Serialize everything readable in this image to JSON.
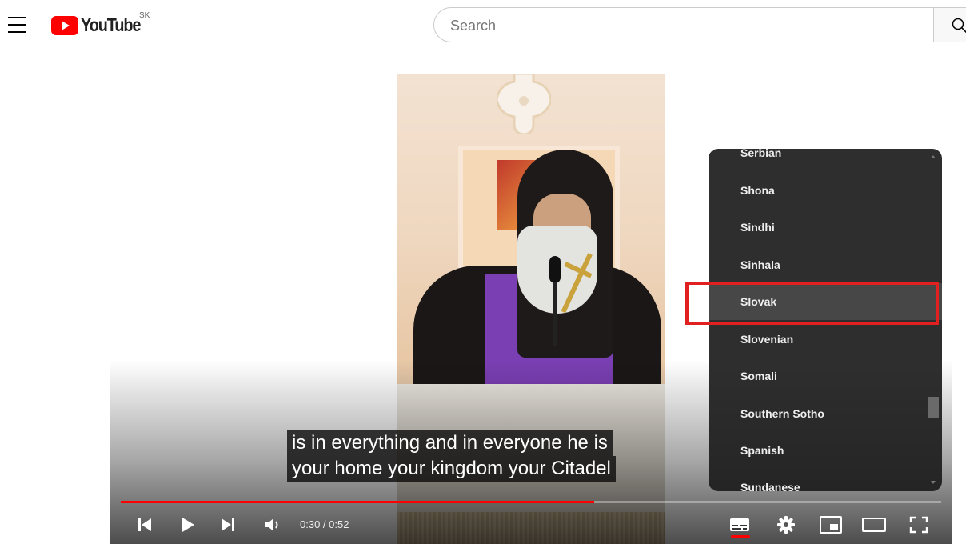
{
  "header": {
    "logo_text": "YouTube",
    "country_code": "SK",
    "search": {
      "placeholder": "Search",
      "value": ""
    }
  },
  "player": {
    "caption_lines": [
      "is in everything and in everyone he is",
      "your home your kingdom your Citadel"
    ],
    "progress": 0.577,
    "time_current": "0:30",
    "time_total": "0:52",
    "time_display": "0:30 / 0:52"
  },
  "language_menu": {
    "items": [
      "Serbian",
      "Shona",
      "Sindhi",
      "Sinhala",
      "Slovak",
      "Slovenian",
      "Somali",
      "Southern Sotho",
      "Spanish",
      "Sundanese"
    ],
    "selected": "Slovak"
  },
  "colors": {
    "brand_red": "#ff0000",
    "highlight_outline": "#e0211f",
    "menu_background": "#1c1c1c"
  },
  "icons": {
    "menu": "hamburger-menu-icon",
    "search": "search-icon",
    "previous": "previous-icon",
    "play": "play-icon",
    "next": "next-icon",
    "volume": "volume-icon",
    "subtitles": "subtitles-icon",
    "settings": "gear-icon",
    "miniplayer": "miniplayer-icon",
    "theater": "theater-mode-icon",
    "fullscreen": "fullscreen-icon"
  }
}
